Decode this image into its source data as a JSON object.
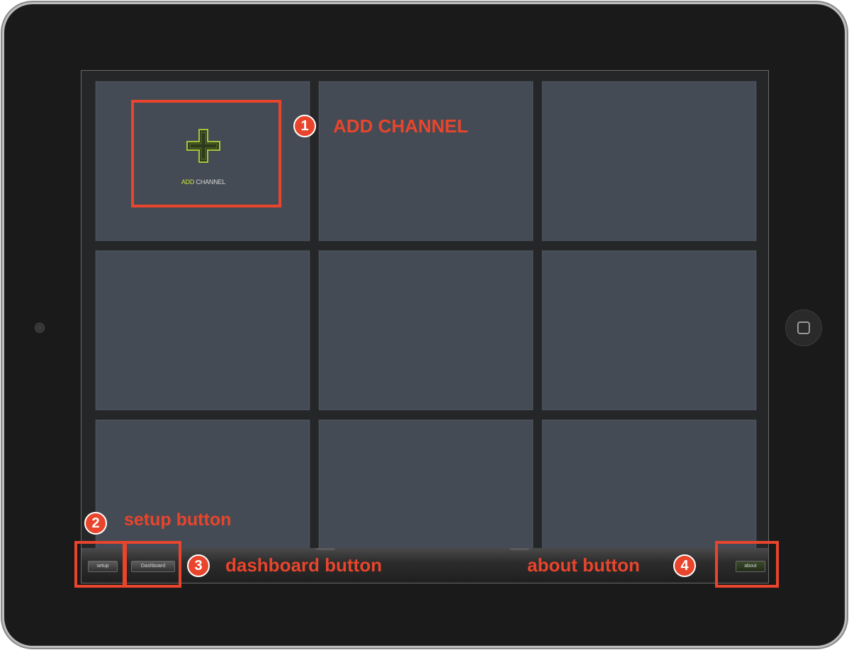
{
  "grid": {
    "tiles": [
      "tile-1",
      "tile-2",
      "tile-3",
      "tile-4",
      "tile-5",
      "tile-6",
      "tile-7",
      "tile-8",
      "tile-9"
    ],
    "add_channel": {
      "icon": "plus-icon",
      "label_part1": "ADD",
      "label_part2": " CHANNEL",
      "accent_color": "#c6e23c"
    }
  },
  "toolbar": {
    "setup_label": "setup",
    "dashboard_label": "Dashboard",
    "about_label": "about"
  },
  "callouts": [
    {
      "number": "1",
      "text": "ADD CHANNEL"
    },
    {
      "number": "2",
      "text": "setup button"
    },
    {
      "number": "3",
      "text": "dashboard button"
    },
    {
      "number": "4",
      "text": "about button"
    }
  ],
  "colors": {
    "callout": "#e8452c",
    "tile": "#444b55",
    "background": "#252627",
    "bezel": "#1a1a1a"
  }
}
